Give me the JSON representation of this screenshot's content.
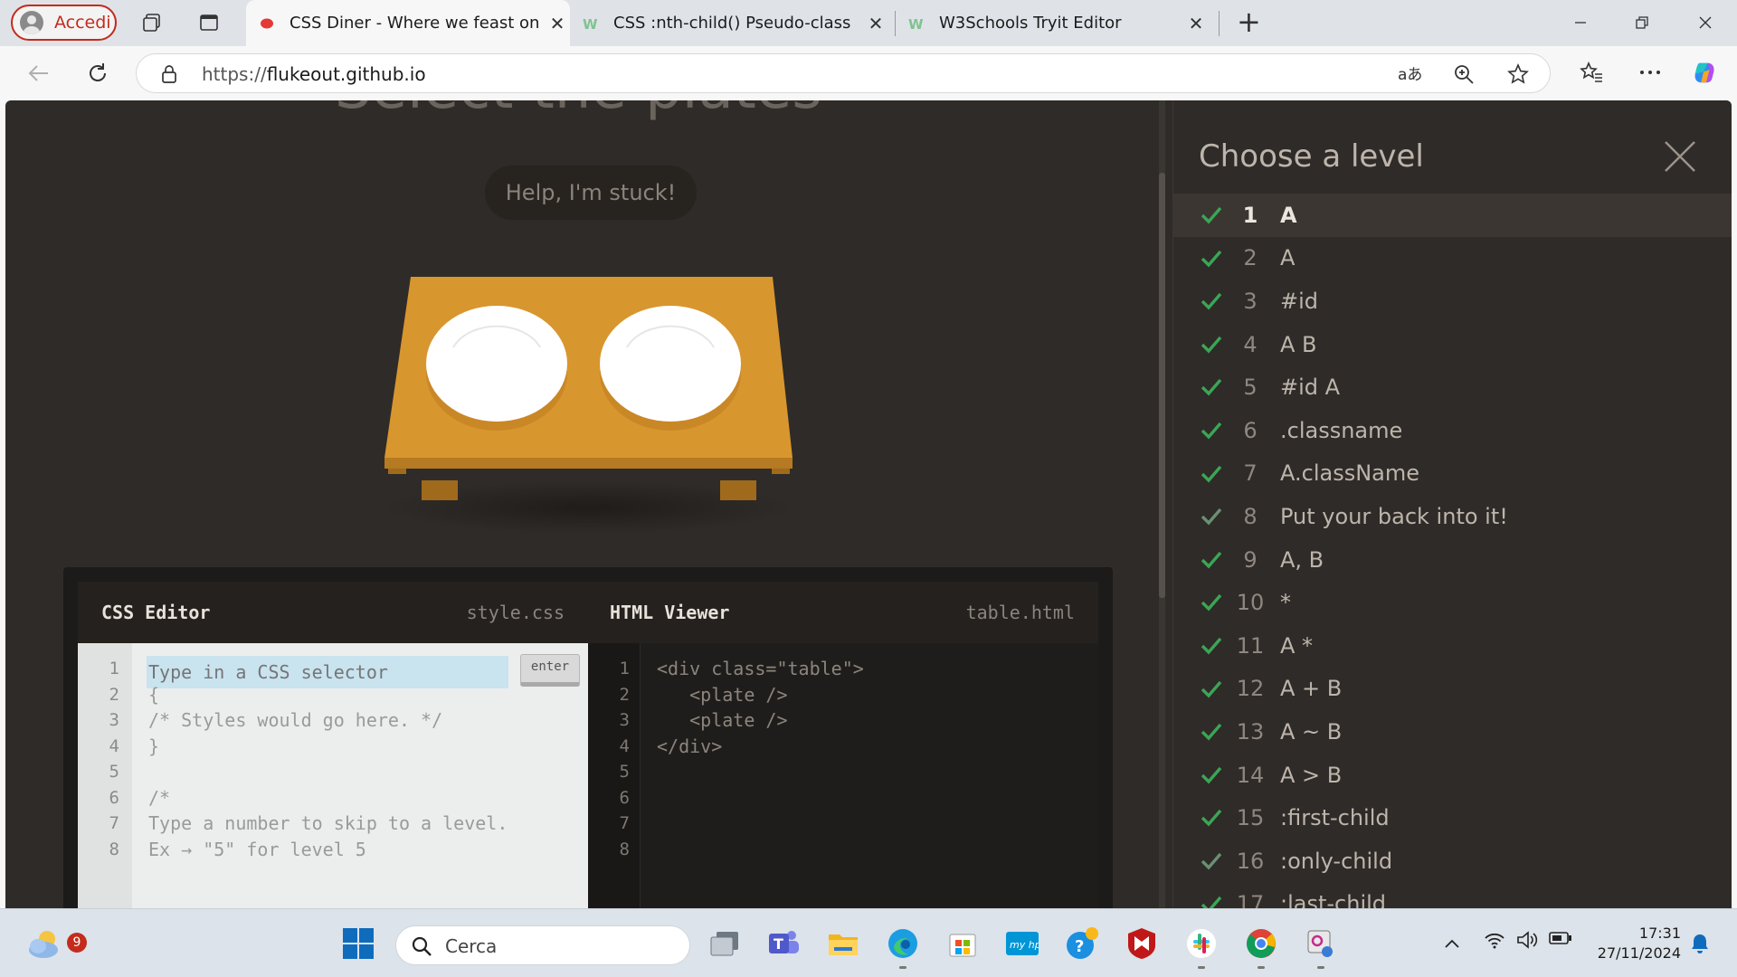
{
  "browser": {
    "profile_label": "Accedi",
    "tabs": [
      {
        "title": "CSS Diner - Where we feast on CSS",
        "active": true
      },
      {
        "title": "CSS :nth-child() Pseudo-class",
        "active": false
      },
      {
        "title": "W3Schools Tryit Editor",
        "active": false
      }
    ],
    "url_prefix": "https://",
    "url_host": "flukeout.github.io"
  },
  "page": {
    "heading": "Select the plates",
    "help_button": "Help, I'm stuck!",
    "css_editor": {
      "title": "CSS Editor",
      "file": "style.css",
      "input_placeholder": "Type in a CSS selector",
      "enter_label": "enter",
      "lines": [
        "",
        "{",
        "/* Styles would go here. */",
        "}",
        "",
        "/*",
        "Type a number to skip to a level.",
        "Ex → \"5\" for level 5"
      ],
      "line_numbers": [
        "1",
        "2",
        "3",
        "4",
        "5",
        "6",
        "7",
        "8"
      ]
    },
    "html_viewer": {
      "title": "HTML Viewer",
      "file": "table.html",
      "lines": [
        "<div class=\"table\">",
        "   <plate />",
        "   <plate />",
        "</div>",
        "",
        "",
        "",
        ""
      ],
      "line_numbers": [
        "1",
        "2",
        "3",
        "4",
        "5",
        "6",
        "7",
        "8"
      ]
    }
  },
  "levels_panel": {
    "title": "Choose a level",
    "levels": [
      {
        "num": "1",
        "name": "A",
        "done": true,
        "current": true
      },
      {
        "num": "2",
        "name": "A",
        "done": true
      },
      {
        "num": "3",
        "name": "#id",
        "done": true
      },
      {
        "num": "4",
        "name": "A  B",
        "done": true
      },
      {
        "num": "5",
        "name": "#id  A",
        "done": true
      },
      {
        "num": "6",
        "name": ".classname",
        "done": true
      },
      {
        "num": "7",
        "name": "A.className",
        "done": true
      },
      {
        "num": "8",
        "name": "Put your back into it!",
        "done": false
      },
      {
        "num": "9",
        "name": "A, B",
        "done": true
      },
      {
        "num": "10",
        "name": "*",
        "done": true
      },
      {
        "num": "11",
        "name": "A  *",
        "done": true
      },
      {
        "num": "12",
        "name": "A + B",
        "done": true
      },
      {
        "num": "13",
        "name": "A ~ B",
        "done": true
      },
      {
        "num": "14",
        "name": "A > B",
        "done": true
      },
      {
        "num": "15",
        "name": ":first-child",
        "done": true
      },
      {
        "num": "16",
        "name": ":only-child",
        "done": false
      },
      {
        "num": "17",
        "name": ":last-child",
        "done": true
      }
    ]
  },
  "taskbar": {
    "search_label": "Cerca",
    "weather_badge": "9",
    "time": "17:31",
    "date": "27/11/2024"
  },
  "colors": {
    "check_done": "#3aa655",
    "check_pending": "#6b8f73",
    "table_wood": "#d8962e"
  }
}
